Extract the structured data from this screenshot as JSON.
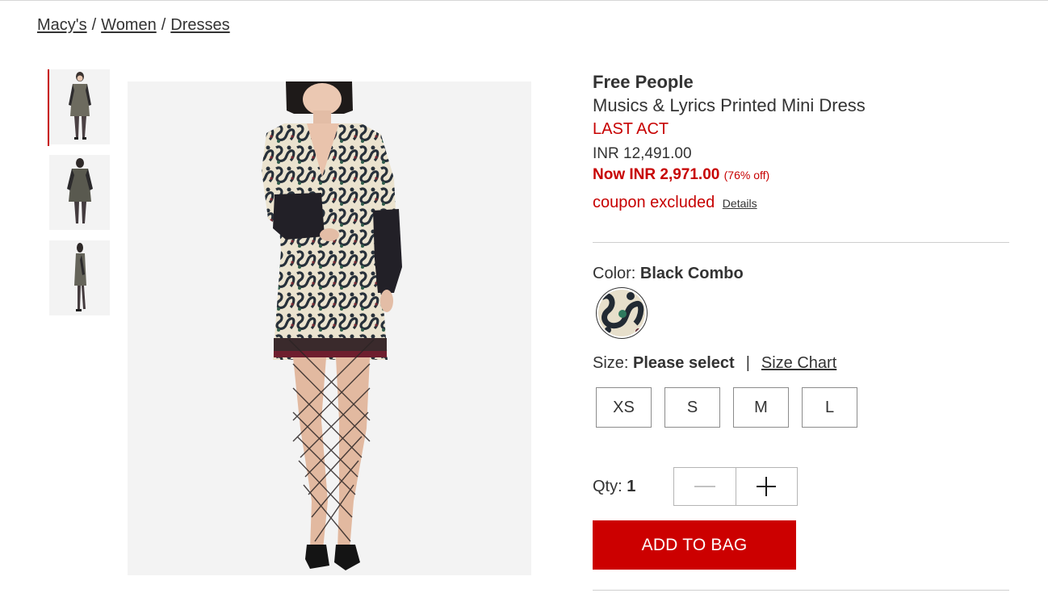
{
  "breadcrumb": {
    "items": [
      "Macy's",
      "Women",
      "Dresses"
    ],
    "separator": "/"
  },
  "gallery": {
    "thumbnails": [
      {
        "view": "front",
        "selected": true
      },
      {
        "view": "back",
        "selected": false
      },
      {
        "view": "side",
        "selected": false
      }
    ],
    "main_image_view": "front"
  },
  "product": {
    "brand": "Free People",
    "name": "Musics & Lyrics Printed Mini Dress",
    "promo_tag": "LAST ACT",
    "original_price": "INR 12,491.00",
    "sale_price": "Now INR 2,971.00",
    "discount": "(76% off)",
    "coupon_text": "coupon excluded",
    "coupon_details_link": "Details"
  },
  "color": {
    "label": "Color:",
    "selected": "Black Combo"
  },
  "size": {
    "label": "Size:",
    "selected": "Please select",
    "separator": "|",
    "chart_link": "Size Chart",
    "options": [
      "XS",
      "S",
      "M",
      "L"
    ]
  },
  "quantity": {
    "label": "Qty:",
    "value": "1",
    "decrement_icon": "minus-icon",
    "increment_icon": "plus-icon"
  },
  "add_to_bag": "ADD TO BAG",
  "colors": {
    "accent_red": "#cc0000",
    "sale_red": "#c70000",
    "text": "#333333",
    "divider": "#cfcfcf"
  }
}
